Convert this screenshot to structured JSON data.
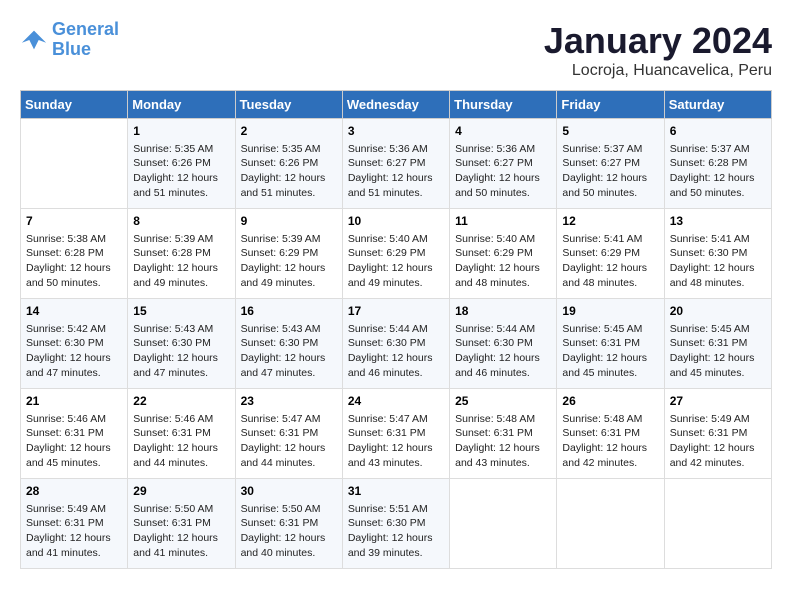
{
  "header": {
    "logo_general": "General",
    "logo_blue": "Blue",
    "month": "January 2024",
    "location": "Locroja, Huancavelica, Peru"
  },
  "days_of_week": [
    "Sunday",
    "Monday",
    "Tuesday",
    "Wednesday",
    "Thursday",
    "Friday",
    "Saturday"
  ],
  "weeks": [
    [
      {
        "num": "",
        "info": ""
      },
      {
        "num": "1",
        "info": "Sunrise: 5:35 AM\nSunset: 6:26 PM\nDaylight: 12 hours\nand 51 minutes."
      },
      {
        "num": "2",
        "info": "Sunrise: 5:35 AM\nSunset: 6:26 PM\nDaylight: 12 hours\nand 51 minutes."
      },
      {
        "num": "3",
        "info": "Sunrise: 5:36 AM\nSunset: 6:27 PM\nDaylight: 12 hours\nand 51 minutes."
      },
      {
        "num": "4",
        "info": "Sunrise: 5:36 AM\nSunset: 6:27 PM\nDaylight: 12 hours\nand 50 minutes."
      },
      {
        "num": "5",
        "info": "Sunrise: 5:37 AM\nSunset: 6:27 PM\nDaylight: 12 hours\nand 50 minutes."
      },
      {
        "num": "6",
        "info": "Sunrise: 5:37 AM\nSunset: 6:28 PM\nDaylight: 12 hours\nand 50 minutes."
      }
    ],
    [
      {
        "num": "7",
        "info": "Sunrise: 5:38 AM\nSunset: 6:28 PM\nDaylight: 12 hours\nand 50 minutes."
      },
      {
        "num": "8",
        "info": "Sunrise: 5:39 AM\nSunset: 6:28 PM\nDaylight: 12 hours\nand 49 minutes."
      },
      {
        "num": "9",
        "info": "Sunrise: 5:39 AM\nSunset: 6:29 PM\nDaylight: 12 hours\nand 49 minutes."
      },
      {
        "num": "10",
        "info": "Sunrise: 5:40 AM\nSunset: 6:29 PM\nDaylight: 12 hours\nand 49 minutes."
      },
      {
        "num": "11",
        "info": "Sunrise: 5:40 AM\nSunset: 6:29 PM\nDaylight: 12 hours\nand 48 minutes."
      },
      {
        "num": "12",
        "info": "Sunrise: 5:41 AM\nSunset: 6:29 PM\nDaylight: 12 hours\nand 48 minutes."
      },
      {
        "num": "13",
        "info": "Sunrise: 5:41 AM\nSunset: 6:30 PM\nDaylight: 12 hours\nand 48 minutes."
      }
    ],
    [
      {
        "num": "14",
        "info": "Sunrise: 5:42 AM\nSunset: 6:30 PM\nDaylight: 12 hours\nand 47 minutes."
      },
      {
        "num": "15",
        "info": "Sunrise: 5:43 AM\nSunset: 6:30 PM\nDaylight: 12 hours\nand 47 minutes."
      },
      {
        "num": "16",
        "info": "Sunrise: 5:43 AM\nSunset: 6:30 PM\nDaylight: 12 hours\nand 47 minutes."
      },
      {
        "num": "17",
        "info": "Sunrise: 5:44 AM\nSunset: 6:30 PM\nDaylight: 12 hours\nand 46 minutes."
      },
      {
        "num": "18",
        "info": "Sunrise: 5:44 AM\nSunset: 6:30 PM\nDaylight: 12 hours\nand 46 minutes."
      },
      {
        "num": "19",
        "info": "Sunrise: 5:45 AM\nSunset: 6:31 PM\nDaylight: 12 hours\nand 45 minutes."
      },
      {
        "num": "20",
        "info": "Sunrise: 5:45 AM\nSunset: 6:31 PM\nDaylight: 12 hours\nand 45 minutes."
      }
    ],
    [
      {
        "num": "21",
        "info": "Sunrise: 5:46 AM\nSunset: 6:31 PM\nDaylight: 12 hours\nand 45 minutes."
      },
      {
        "num": "22",
        "info": "Sunrise: 5:46 AM\nSunset: 6:31 PM\nDaylight: 12 hours\nand 44 minutes."
      },
      {
        "num": "23",
        "info": "Sunrise: 5:47 AM\nSunset: 6:31 PM\nDaylight: 12 hours\nand 44 minutes."
      },
      {
        "num": "24",
        "info": "Sunrise: 5:47 AM\nSunset: 6:31 PM\nDaylight: 12 hours\nand 43 minutes."
      },
      {
        "num": "25",
        "info": "Sunrise: 5:48 AM\nSunset: 6:31 PM\nDaylight: 12 hours\nand 43 minutes."
      },
      {
        "num": "26",
        "info": "Sunrise: 5:48 AM\nSunset: 6:31 PM\nDaylight: 12 hours\nand 42 minutes."
      },
      {
        "num": "27",
        "info": "Sunrise: 5:49 AM\nSunset: 6:31 PM\nDaylight: 12 hours\nand 42 minutes."
      }
    ],
    [
      {
        "num": "28",
        "info": "Sunrise: 5:49 AM\nSunset: 6:31 PM\nDaylight: 12 hours\nand 41 minutes."
      },
      {
        "num": "29",
        "info": "Sunrise: 5:50 AM\nSunset: 6:31 PM\nDaylight: 12 hours\nand 41 minutes."
      },
      {
        "num": "30",
        "info": "Sunrise: 5:50 AM\nSunset: 6:31 PM\nDaylight: 12 hours\nand 40 minutes."
      },
      {
        "num": "31",
        "info": "Sunrise: 5:51 AM\nSunset: 6:30 PM\nDaylight: 12 hours\nand 39 minutes."
      },
      {
        "num": "",
        "info": ""
      },
      {
        "num": "",
        "info": ""
      },
      {
        "num": "",
        "info": ""
      }
    ]
  ]
}
